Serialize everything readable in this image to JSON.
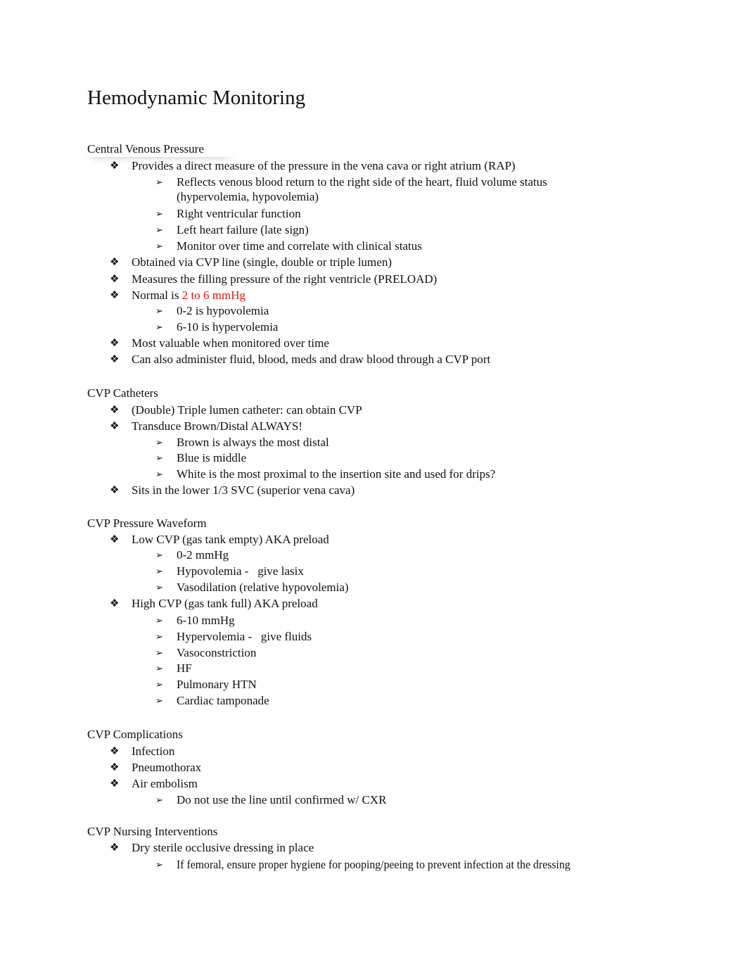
{
  "document": {
    "title": "Hemodynamic Monitoring",
    "bullet1_glyph": "❖",
    "bullet2_glyph": "➢",
    "highlight_color": "#ee1111",
    "sections": {
      "cvp": {
        "heading": "Central Venous Pressure",
        "i0": "Provides a direct measure of the pressure in the vena cava or right atrium (RAP)",
        "i0_s0_l1": "Reflects venous blood return to the right side of the heart, fluid volume status",
        "i0_s0_l2": "(hypervolemia, hypovolemia)",
        "i0_s1": "Right ventricular function",
        "i0_s2": "Left heart failure (late sign)",
        "i0_s3": "Monitor over time and correlate with clinical status",
        "i1": "Obtained via CVP line (single, double or triple lumen)",
        "i2": "Measures the filling pressure of the right ventricle (PRELOAD)",
        "i3_prefix": "Normal is ",
        "i3_value": "2 to 6 mmHg",
        "i3_s0": "0-2 is hypovolemia",
        "i3_s1": "6-10 is hypervolemia",
        "i4": "Most valuable when monitored over time",
        "i5": "Can also administer fluid, blood, meds and draw blood through a CVP port"
      },
      "catheters": {
        "heading": "CVP Catheters",
        "i0": "(Double) Triple lumen catheter: can obtain CVP",
        "i1": "Transduce Brown/Distal ALWAYS!",
        "i1_s0": "Brown is always the most distal",
        "i1_s1": "Blue is middle",
        "i1_s2": "White is the most proximal to the insertion site and used for drips?",
        "i2": "Sits in the lower 1/3 SVC (superior vena cava)"
      },
      "waveform": {
        "heading": "CVP Pressure Waveform",
        "i0": "Low CVP (gas tank empty) AKA preload",
        "i0_s0": "0-2 mmHg",
        "i0_s1": "Hypovolemia -   give lasix",
        "i0_s2": "Vasodilation (relative hypovolemia)",
        "i1": "High CVP (gas tank full) AKA preload",
        "i1_s0": "6-10 mmHg",
        "i1_s1": "Hypervolemia -   give fluids",
        "i1_s2": "Vasoconstriction",
        "i1_s3": "HF",
        "i1_s4": "Pulmonary HTN",
        "i1_s5": "Cardiac tamponade"
      },
      "complications": {
        "heading": "CVP Complications",
        "i0": "Infection",
        "i1": "Pneumothorax",
        "i2": "Air embolism",
        "i2_s0": "Do not use the line until confirmed w/ CXR"
      },
      "nursing": {
        "heading": "CVP Nursing Interventions",
        "i0": "Dry sterile occlusive dressing in place",
        "i0_s0": "If femoral, ensure proper hygiene for pooping/peeing to prevent infection at the dressing"
      }
    }
  }
}
